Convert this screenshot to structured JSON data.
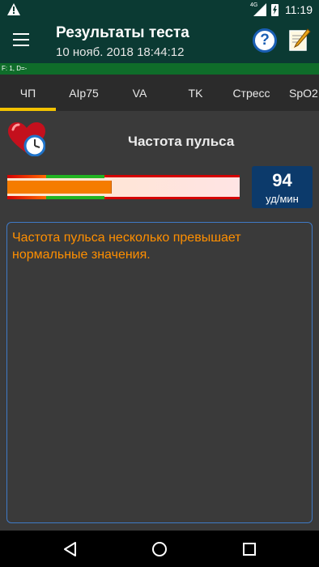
{
  "status_bar": {
    "network": "4G",
    "time": "11:19"
  },
  "app_bar": {
    "title": "Результаты теста",
    "subtitle": "10 нояб. 2018  18:44:12"
  },
  "info_bar": {
    "text": "F: 1, D=-"
  },
  "tabs": [
    {
      "label": "ЧП",
      "active": true
    },
    {
      "label": "AIp75",
      "active": false
    },
    {
      "label": "VA",
      "active": false
    },
    {
      "label": "TK",
      "active": false
    },
    {
      "label": "Стресс",
      "active": false
    },
    {
      "label": "SpO2",
      "active": false
    }
  ],
  "section": {
    "title": "Частота пульса"
  },
  "gauge": {
    "level_fraction": 0.45
  },
  "reading": {
    "value": "94",
    "unit": "уд/мин"
  },
  "message": {
    "text": "Частота пульса несколько превышает нормальные значения."
  },
  "colors": {
    "appbar": "#0b3a33",
    "tab_indicator": "#f2c200",
    "message_text": "#ff8f00",
    "value_box": "#0c3a6b",
    "gauge_fill": "#f57c00"
  },
  "icons": {
    "status_left": "warning-icon",
    "menu": "menu-icon",
    "help": "help-icon",
    "edit": "edit-notes-icon",
    "section": "heart-clock-icon",
    "nav": [
      "back-icon",
      "home-icon",
      "recents-icon"
    ]
  }
}
